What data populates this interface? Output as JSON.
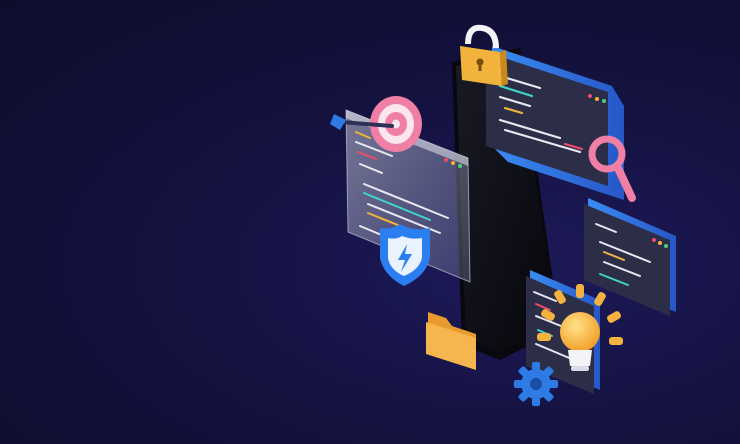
{
  "scene": {
    "description_free": true,
    "colors": {
      "background": "#141240",
      "phone_body": "#0b0b12",
      "panel_blue": "#2f6fdc",
      "panel_dark": "#2b2d45",
      "glass": "#a7adc4",
      "lock_gold": "#f2b33d",
      "target_pink": "#ef7fa5",
      "shield_blue": "#2b7ef0",
      "folder_orange": "#f2b04a",
      "gear_blue": "#2f7be6",
      "bulb_orange": "#f6b23f"
    },
    "icons": [
      "lock-icon",
      "target-icon",
      "arrow-icon",
      "magnifier-icon",
      "shield-icon",
      "bolt-icon",
      "folder-icon",
      "gear-icon",
      "lightbulb-icon"
    ]
  }
}
